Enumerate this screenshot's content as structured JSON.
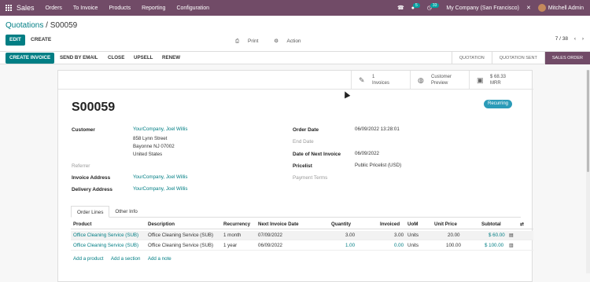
{
  "topbar": {
    "brand": "Sales",
    "menus": [
      "Orders",
      "To Invoice",
      "Products",
      "Reporting",
      "Configuration"
    ],
    "chat_count": "5",
    "activity_count": "33",
    "company": "My Company (San Francisco)",
    "user": "Mitchell Admin"
  },
  "control": {
    "breadcrumb_parent": "Quotations",
    "breadcrumb_sep": " / ",
    "breadcrumb_current": "S00059",
    "edit_label": "EDIT",
    "create_label": "CREATE",
    "print_label": "Print",
    "action_label": "Action",
    "pager": "7 / 38"
  },
  "statusbar": {
    "buttons": [
      "CREATE INVOICE",
      "SEND BY EMAIL",
      "CLOSE",
      "UPSELL",
      "RENEW"
    ],
    "stages": [
      "QUOTATION",
      "QUOTATION SENT",
      "SALES ORDER"
    ],
    "active_stage": "SALES ORDER"
  },
  "smart_buttons": {
    "invoices_count": "1",
    "invoices_label": "Invoices",
    "preview_line1": "Customer",
    "preview_line2": "Preview",
    "mrr_value": "$ 68.33",
    "mrr_label": "MRR"
  },
  "order": {
    "name": "S00059",
    "recurring_label": "Recurring",
    "customer_label": "Customer",
    "customer_name": "YourCompany, Joel Willis",
    "address_line1": "858 Lynn Street",
    "address_line2": "Bayonne NJ 07002",
    "address_line3": "United States",
    "referrer_label": "Referrer",
    "invoice_address_label": "Invoice Address",
    "invoice_address": "YourCompany, Joel Willis",
    "delivery_address_label": "Delivery Address",
    "delivery_address": "YourCompany, Joel Willis",
    "order_date_label": "Order Date",
    "order_date": "06/09/2022 13:28:01",
    "end_date_label": "End Date",
    "next_invoice_label": "Date of Next Invoice",
    "next_invoice_date": "06/09/2022",
    "pricelist_label": "Pricelist",
    "pricelist": "Public Pricelist (USD)",
    "payment_terms_label": "Payment Terms"
  },
  "tabs": [
    "Order Lines",
    "Other Info"
  ],
  "lines": {
    "headers": [
      "Product",
      "Description",
      "Recurrency",
      "Next Invoice Date",
      "Quantity",
      "Invoiced",
      "UoM",
      "Unit Price",
      "Subtotal"
    ],
    "rows": [
      [
        "Office Cleaning Service (SUB)",
        "Office Cleaning Service (SUB)",
        "1 month",
        "07/09/2022",
        "3.00",
        "3.00",
        "Units",
        "20.00",
        "$ 60.00"
      ],
      [
        "Office Cleaning Service (SUB)",
        "Office Cleaning Service (SUB)",
        "1 year",
        "06/09/2022",
        "1.00",
        "0.00",
        "Units",
        "100.00",
        "$ 100.00"
      ]
    ],
    "add_product": "Add a product",
    "add_section": "Add a section",
    "add_note": "Add a note"
  }
}
